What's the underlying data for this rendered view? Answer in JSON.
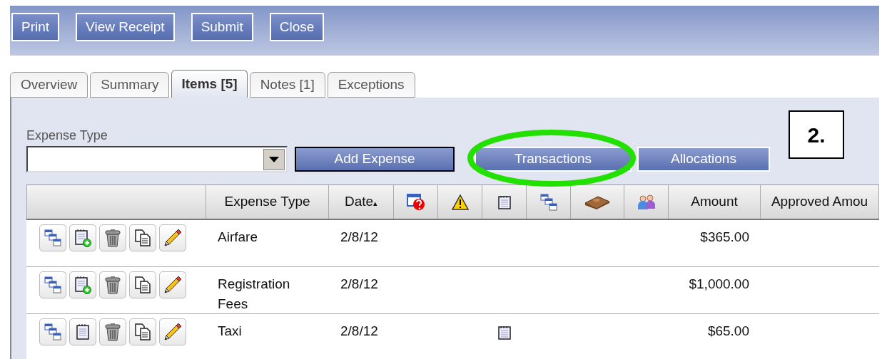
{
  "toolbar": {
    "buttons": [
      "Print",
      "View Receipt",
      "Submit",
      "Close"
    ]
  },
  "tabs": [
    {
      "label": "Overview",
      "selected": false
    },
    {
      "label": "Summary",
      "selected": false
    },
    {
      "label": "Items [5]",
      "selected": true
    },
    {
      "label": "Notes [1]",
      "selected": false
    },
    {
      "label": "Exceptions",
      "selected": false
    }
  ],
  "expense_type": {
    "label": "Expense Type"
  },
  "buttons": [
    {
      "label": "Add Expense",
      "highlighted": false,
      "focused": true
    },
    {
      "label": "Transactions",
      "highlighted": true,
      "focused": false
    },
    {
      "label": "Allocations",
      "highlighted": false,
      "focused": false
    }
  ],
  "annotation": "2.",
  "table": {
    "columns": [
      {
        "kind": "blank"
      },
      {
        "kind": "text",
        "label": "Expense Type"
      },
      {
        "kind": "text",
        "label": "Date",
        "sort": "▴"
      },
      {
        "kind": "missing-receipt"
      },
      {
        "kind": "warning"
      },
      {
        "kind": "note"
      },
      {
        "kind": "split"
      },
      {
        "kind": "wallet"
      },
      {
        "kind": "people"
      },
      {
        "kind": "text",
        "label": "Amount"
      },
      {
        "kind": "text",
        "label": "Approved Amou"
      }
    ],
    "rows": [
      {
        "actions": [
          {
            "kind": "split"
          },
          {
            "kind": "note-add"
          },
          {
            "kind": "trash"
          },
          {
            "kind": "copy"
          },
          {
            "kind": "pencil"
          }
        ],
        "expense_type": "Airfare",
        "date": "2/8/12",
        "note": false,
        "amount": "$365.00"
      },
      {
        "actions": [
          {
            "kind": "split"
          },
          {
            "kind": "note-add"
          },
          {
            "kind": "trash"
          },
          {
            "kind": "copy"
          },
          {
            "kind": "pencil"
          }
        ],
        "expense_type": "Registration Fees",
        "date": "2/8/12",
        "note": false,
        "amount": "$1,000.00"
      },
      {
        "actions": [
          {
            "kind": "split"
          },
          {
            "kind": "note"
          },
          {
            "kind": "trash"
          },
          {
            "kind": "copy"
          },
          {
            "kind": "pencil"
          }
        ],
        "expense_type": "Taxi",
        "date": "2/8/12",
        "note": true,
        "amount": "$65.00"
      }
    ]
  }
}
